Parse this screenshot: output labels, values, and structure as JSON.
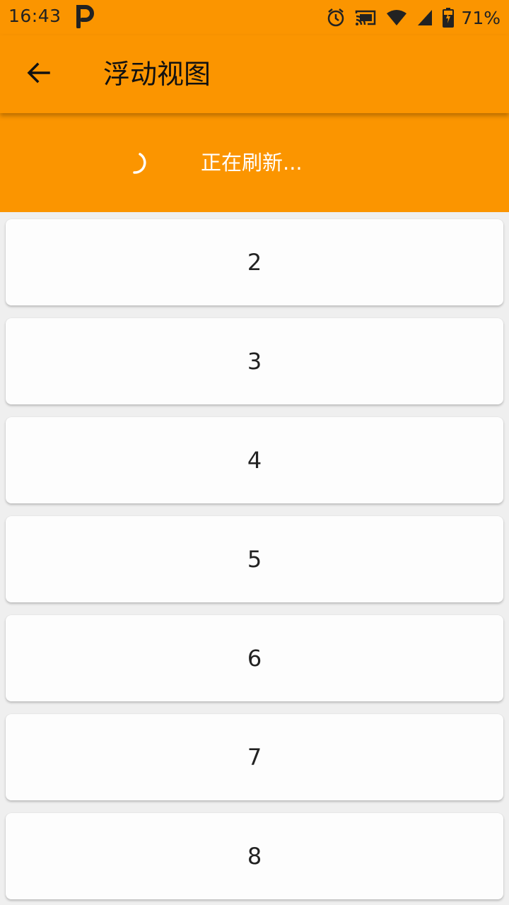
{
  "status_bar": {
    "time": "16:43",
    "battery_percent": "71%",
    "icons": [
      "parking-app-icon",
      "alarm-icon",
      "cast-icon",
      "wifi-icon",
      "cell-signal-icon",
      "battery-charging-icon"
    ]
  },
  "app_bar": {
    "title": "浮动视图",
    "back_icon": "arrow-back-icon"
  },
  "refresh": {
    "text": "正在刷新..."
  },
  "list": {
    "items": [
      "2",
      "3",
      "4",
      "5",
      "6",
      "7",
      "8"
    ]
  },
  "colors": {
    "primary": "#fb9500",
    "card": "#fdfdfd",
    "background": "#efefef"
  }
}
